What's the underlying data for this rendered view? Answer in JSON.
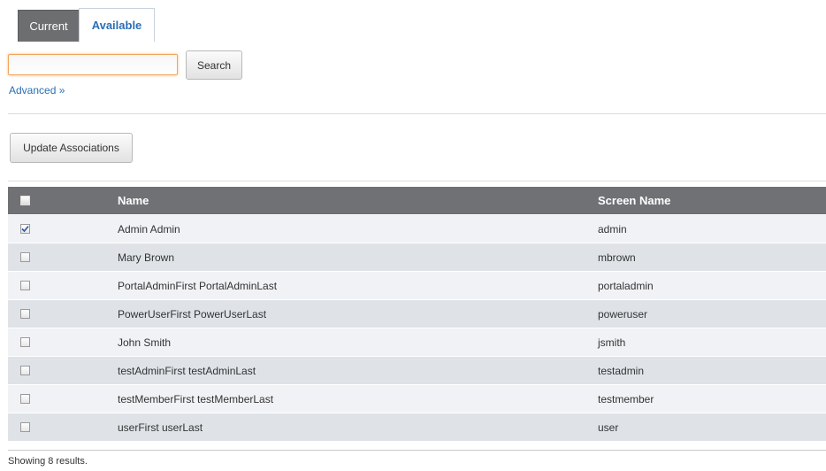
{
  "tabs": {
    "current": "Current",
    "available": "Available",
    "active": "Available"
  },
  "search": {
    "value": "",
    "placeholder": "",
    "button_label": "Search",
    "advanced_label": "Advanced »"
  },
  "actions": {
    "update_label": "Update Associations"
  },
  "table": {
    "columns": {
      "name": "Name",
      "screen_name": "Screen Name"
    },
    "rows": [
      {
        "name": "Admin Admin",
        "screen_name": "admin",
        "checked": true
      },
      {
        "name": "Mary Brown",
        "screen_name": "mbrown",
        "checked": false
      },
      {
        "name": "PortalAdminFirst PortalAdminLast",
        "screen_name": "portaladmin",
        "checked": false
      },
      {
        "name": "PowerUserFirst PowerUserLast",
        "screen_name": "poweruser",
        "checked": false
      },
      {
        "name": "John Smith",
        "screen_name": "jsmith",
        "checked": false
      },
      {
        "name": "testAdminFirst testAdminLast",
        "screen_name": "testadmin",
        "checked": false
      },
      {
        "name": "testMemberFirst testMemberLast",
        "screen_name": "testmember",
        "checked": false
      },
      {
        "name": "userFirst userLast",
        "screen_name": "user",
        "checked": false
      }
    ]
  },
  "footer": {
    "results_text": "Showing 8 results."
  },
  "colors": {
    "header_bg": "#707174",
    "link": "#2a6fb5",
    "row_odd": "#f0f2f5",
    "row_even": "#dfe3e8",
    "focus_border": "#f0a65a"
  },
  "icons": {
    "checkmark": "checkmark-icon"
  }
}
